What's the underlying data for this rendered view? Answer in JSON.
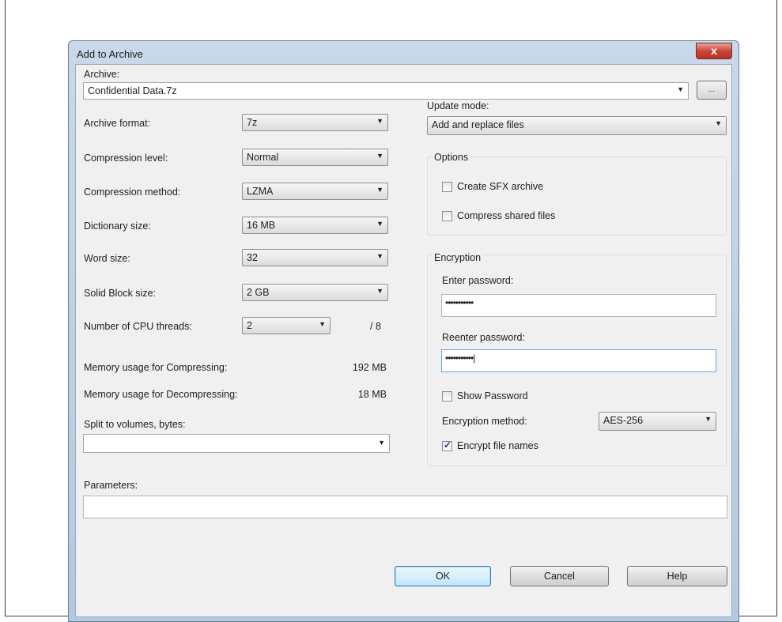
{
  "window": {
    "title": "Add to Archive",
    "close_glyph": "x"
  },
  "archive": {
    "label": "Archive:",
    "value": "Confidential Data.7z",
    "browse_label": "..."
  },
  "left": {
    "archive_format": {
      "label": "Archive format:",
      "value": "7z"
    },
    "compression_level": {
      "label": "Compression level:",
      "value": "Normal"
    },
    "compression_method": {
      "label": "Compression method:",
      "value": "LZMA"
    },
    "dictionary_size": {
      "label": "Dictionary size:",
      "value": "16 MB"
    },
    "word_size": {
      "label": "Word size:",
      "value": "32"
    },
    "solid_block_size": {
      "label": "Solid Block size:",
      "value": "2 GB"
    },
    "cpu_threads": {
      "label": "Number of CPU threads:",
      "value": "2",
      "max": "/ 8"
    },
    "memory_compress": {
      "label": "Memory usage for Compressing:",
      "value": "192 MB"
    },
    "memory_decompress": {
      "label": "Memory usage for Decompressing:",
      "value": "18 MB"
    },
    "split_volumes": {
      "label": "Split to volumes, bytes:",
      "value": ""
    }
  },
  "parameters": {
    "label": "Parameters:",
    "value": ""
  },
  "right": {
    "update_mode": {
      "label": "Update mode:",
      "value": "Add and replace files"
    },
    "options": {
      "title": "Options",
      "create_sfx": "Create SFX archive",
      "compress_shared": "Compress shared files"
    },
    "encryption": {
      "title": "Encryption",
      "enter_password_label": "Enter password:",
      "enter_password_value": "•••••••••••",
      "reenter_password_label": "Reenter password:",
      "reenter_password_value": "•••••••••••|",
      "show_password": "Show Password",
      "method_label": "Encryption method:",
      "method_value": "AES-256",
      "encrypt_names": "Encrypt file names",
      "encrypt_names_checked": true
    }
  },
  "buttons": {
    "ok": "OK",
    "cancel": "Cancel",
    "help": "Help"
  }
}
